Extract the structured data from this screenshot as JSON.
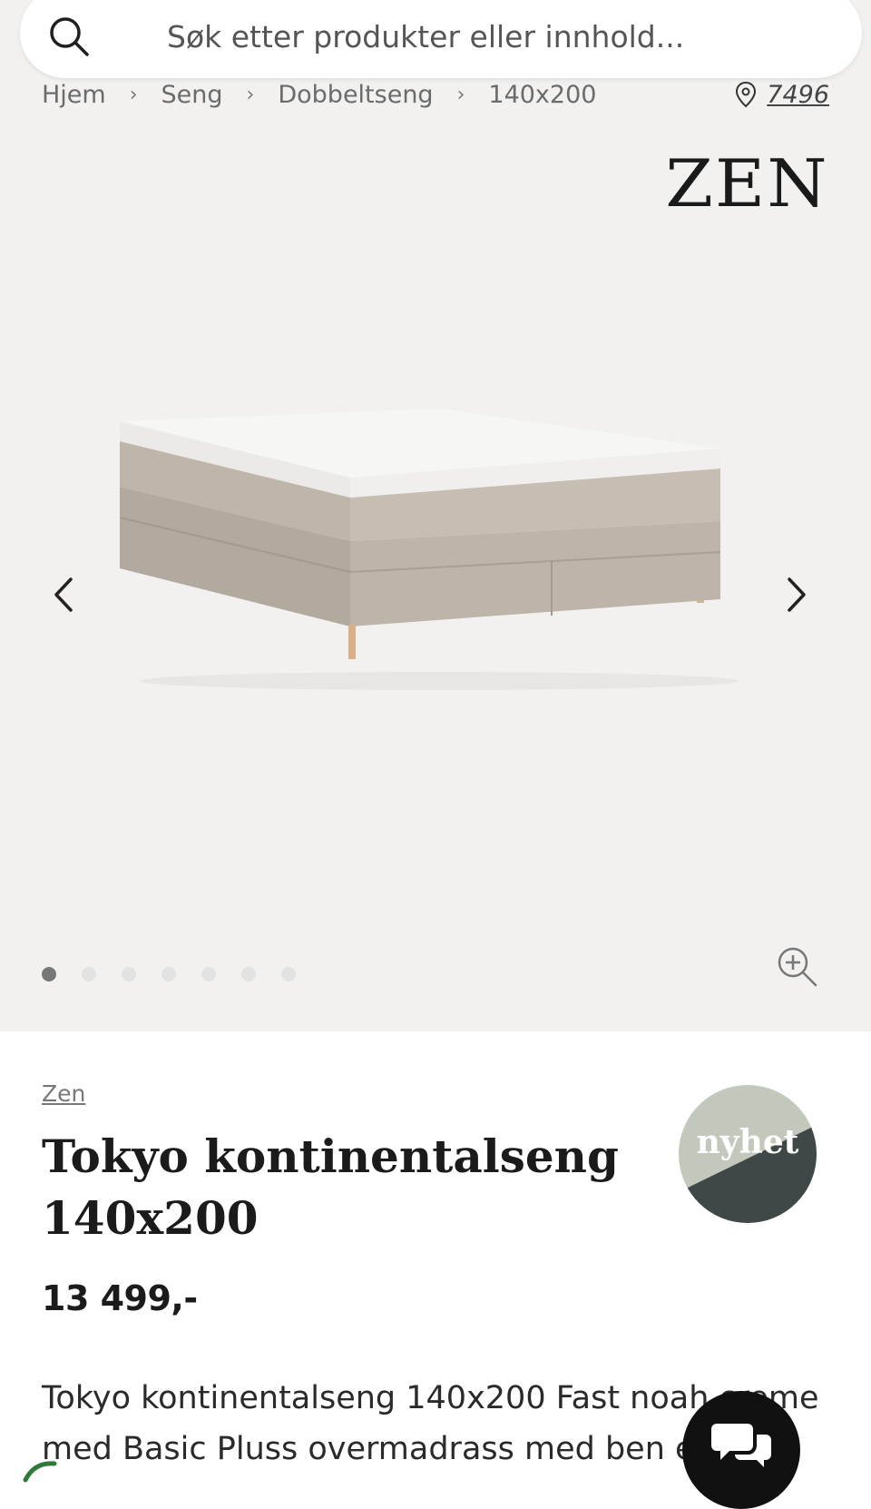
{
  "search": {
    "placeholder": "Søk etter produkter eller innhold..."
  },
  "breadcrumb": {
    "items": [
      "Hjem",
      "Seng",
      "Dobbeltseng",
      "140x200"
    ]
  },
  "store": {
    "number": "7496"
  },
  "gallery": {
    "logo": "ZEN",
    "dot_count": 7,
    "active_dot": 1
  },
  "product": {
    "brand": "Zen",
    "title": "Tokyo kontinentalseng 140x200",
    "badge": "nyhet",
    "price": "13 499,-",
    "description": "Tokyo kontinentalseng 140x200 Fast noah creme med Basic Pluss overmadrass med ben eik"
  },
  "colors": {
    "gallery_bg": "#f2f1f0",
    "badge_light": "#c3c8bd",
    "badge_dark": "#3f4846",
    "fabric": "#b7aea4",
    "legs": "#d9b089"
  }
}
